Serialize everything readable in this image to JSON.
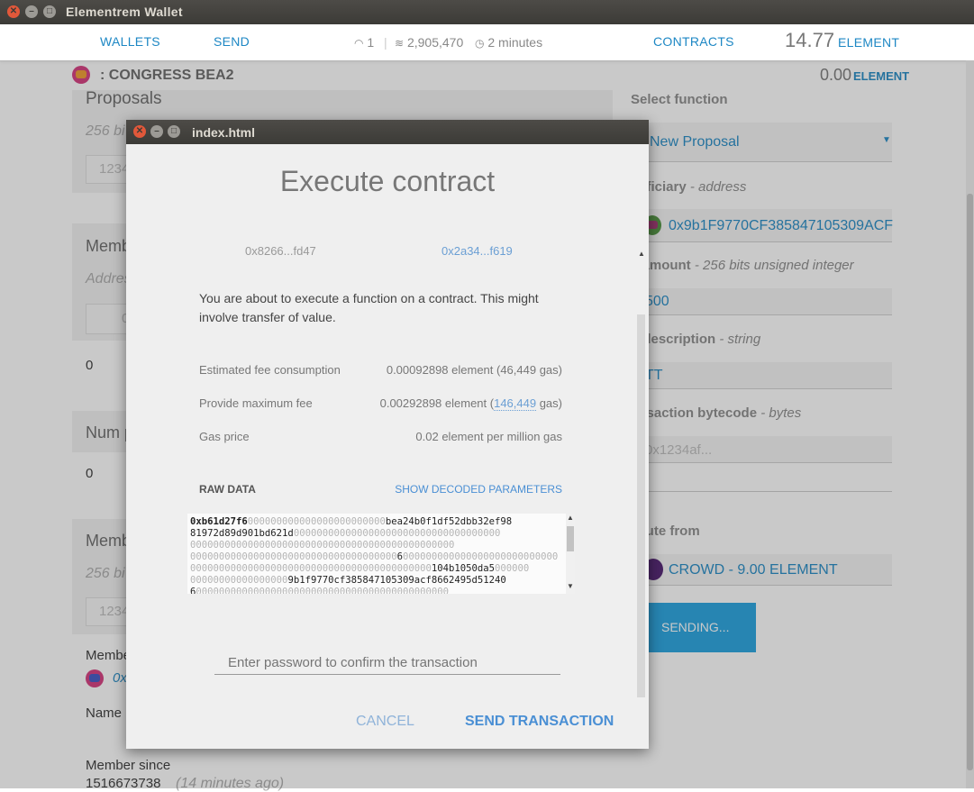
{
  "window": {
    "title": "Elementrem Wallet"
  },
  "nav": {
    "wallets": "WALLETS",
    "send": "SEND",
    "peers": "1",
    "block": "2,905,470",
    "time": "2 minutes",
    "contracts": "CONTRACTS",
    "balance": "14.77",
    "unit": "ELEMENT"
  },
  "contract": {
    "name": ": CONGRESS BEA2",
    "balance": "0.00",
    "unit": "ELEMENT"
  },
  "left": {
    "proposals": "Proposals",
    "proposals_hint": "256 bi",
    "proposals_input": "1234",
    "members": "Memb",
    "address_hint": "Addres",
    "address_input": "0",
    "members_value": "0",
    "num_label": "Num p",
    "num_value": "0",
    "member3": "Memb",
    "member3_hint": "256 bi",
    "member3_input": "1234",
    "member_label": "Membe",
    "member_address": "0x",
    "name_label": "Name",
    "since_label": "Member since",
    "since_value": "1516673738",
    "since_ago": "(14 minutes ago)"
  },
  "right": {
    "select_label": "Select function",
    "select_value": "New Proposal",
    "beneficiary_label": "neficiary",
    "beneficiary_type": " - address",
    "beneficiary_value": "0x9b1F9770CF385847105309ACF",
    "amount_label": "y amount",
    "amount_type": " - 256 bits unsigned integer",
    "amount_value": "500",
    "desc_label": "b description",
    "desc_type": " - string",
    "desc_value": "TT",
    "bytecode_label": "ansaction bytecode",
    "bytecode_type": " - bytes",
    "bytecode_placeholder": "0x1234af...",
    "from_label": "ecute from",
    "from_value": "CROWD - 9.00 ELEMENT",
    "sending": "SENDING..."
  },
  "modal": {
    "window_title": "index.html",
    "heading": "Execute contract",
    "from_addr": "0x8266...fd47",
    "to_addr": "0x2a34...f619",
    "warning": "You are about to execute a function on a contract. This might involve transfer of value.",
    "fee_label": "Estimated fee consumption",
    "fee_value": "0.00092898 element (46,449 gas)",
    "maxfee_label": "Provide maximum fee",
    "maxfee_prefix": "0.00292898 element (",
    "maxfee_gas": "146,449",
    "maxfee_suffix": " gas)",
    "gasprice_label": "Gas price",
    "gasprice_value": "0.02 element per million gas",
    "raw_label": "RAW DATA",
    "decoded_link": "SHOW DECODED PARAMETERS",
    "raw_lines": [
      "0xb61d27f6",
      "000000000000000000000000",
      "bea24b0f1df52dbb32ef98",
      "81972d89d901bd621d",
      "000000000000000000000000000000000000",
      "0000000000000000000000000000000000000000000000",
      "000000000000000000000000000000000000",
      "6",
      "000000000000000000000000000",
      "000000000000000000000000000000000000000000",
      "104b1050da5",
      "000000",
      "00000000000000000",
      "9b1f9770cf385847105309acf8662495d51240",
      "6",
      "00000000000000000000000000000000000000000000"
    ],
    "password_placeholder": "Enter password to confirm the transaction",
    "cancel": "CANCEL",
    "send": "SEND TRANSACTION"
  }
}
